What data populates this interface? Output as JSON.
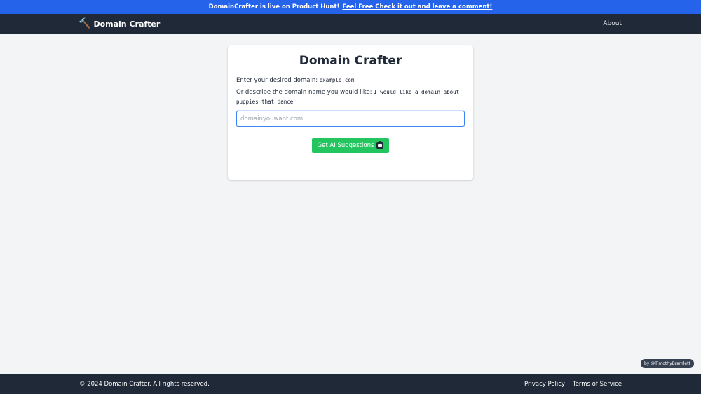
{
  "banner": {
    "text": "DomainCrafter is live on Product Hunt!",
    "link_text": "Feel Free Check it out and leave a comment!"
  },
  "navbar": {
    "brand_icon": "hammer-icon",
    "brand": "Domain Crafter",
    "about": "About"
  },
  "card": {
    "title": "Domain Crafter",
    "line1_label": "Enter your desired domain:",
    "line1_code": "example.com",
    "line2_label": "Or describe the domain name you would like:",
    "line2_code": "I would like a domain about puppies that dance",
    "input_placeholder": "domainyouwant.com",
    "input_value": "",
    "button_label": "Get AI Suggestions",
    "button_icon": "robot-icon"
  },
  "credit": "by @TimothyBramlett",
  "footer": {
    "copyright": "© 2024 Domain Crafter. All rights reserved.",
    "privacy": "Privacy Policy",
    "terms": "Terms of Service"
  },
  "colors": {
    "banner": "#2563eb",
    "navbar": "#1f2937",
    "button": "#22c55e",
    "input_focus": "#3b82f6",
    "background": "#f3f4f6"
  }
}
